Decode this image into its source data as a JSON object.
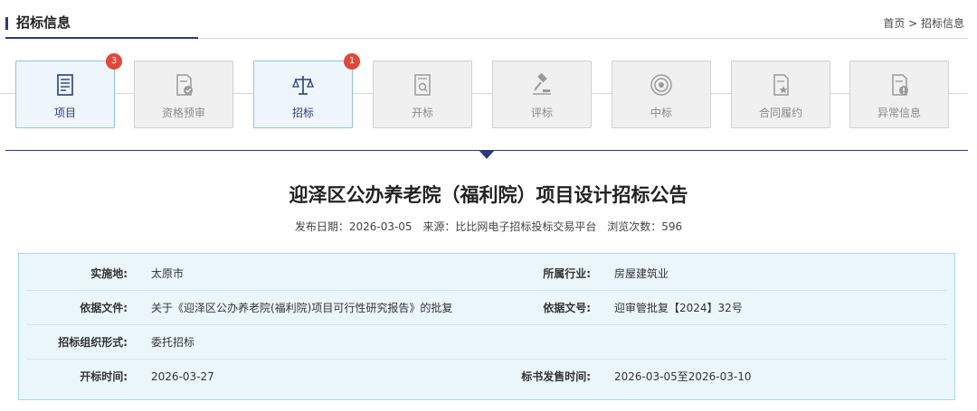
{
  "header": {
    "title": "招标信息",
    "breadcrumb": "首页 > 招标信息"
  },
  "steps": [
    {
      "label": "项目",
      "icon": "document-list-icon",
      "active": true,
      "badge": "3"
    },
    {
      "label": "资格预审",
      "icon": "document-check-icon",
      "active": false,
      "badge": ""
    },
    {
      "label": "招标",
      "icon": "scale-balance-icon",
      "active": true,
      "badge": "1"
    },
    {
      "label": "开标",
      "icon": "document-search-icon",
      "active": false,
      "badge": ""
    },
    {
      "label": "评标",
      "icon": "gavel-icon",
      "active": false,
      "badge": ""
    },
    {
      "label": "中标",
      "icon": "target-icon",
      "active": false,
      "badge": ""
    },
    {
      "label": "合同履约",
      "icon": "document-star-icon",
      "active": false,
      "badge": ""
    },
    {
      "label": "异常信息",
      "icon": "document-alert-icon",
      "active": false,
      "badge": ""
    }
  ],
  "article": {
    "title": "迎泽区公办养老院（福利院）项目设计招标公告",
    "publish_date": "发布日期：2026-03-05",
    "source": "来源：比比网电子招标投标交易平台",
    "views": "浏览次数：596"
  },
  "info": {
    "r1": {
      "k1": "实施地:",
      "v1": "太原市",
      "k2": "所属行业:",
      "v2": "房屋建筑业"
    },
    "r2": {
      "k1": "依据文件:",
      "v1": "关于《迎泽区公办养老院(福利院)项目可行性研究报告》的批复",
      "k2": "依据文号:",
      "v2": "迎审管批复【2024】32号"
    },
    "r3": {
      "k1": "招标组织形式:",
      "v1": "委托招标"
    },
    "r4": {
      "k1": "开标时间:",
      "v1": "2026-03-27",
      "k2": "标书发售时间:",
      "v2": "2026-03-05至2026-03-10"
    }
  },
  "colors": {
    "accent": "#2b3a7a",
    "badge": "#e0483a",
    "active_border": "#8fc2e0",
    "info_bg": "#ebf6fb"
  }
}
